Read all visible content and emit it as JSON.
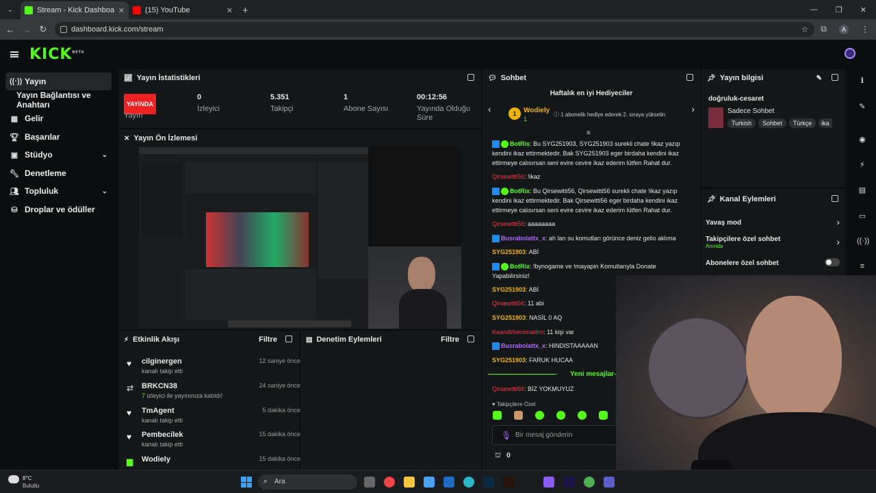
{
  "browser": {
    "tabs": [
      {
        "title": "Stream - Kick Dashboard",
        "active": true,
        "favicon_color": "#53fc18"
      },
      {
        "title": "(15) YouTube",
        "active": false,
        "favicon_color": "#ff0000"
      }
    ],
    "url": "dashboard.kick.com/stream",
    "profile_initial": "A"
  },
  "topbar": {
    "logo": "KICK",
    "logo_sup": "BETA"
  },
  "sidebar": {
    "items": [
      {
        "label": "Yayın",
        "icon": "broadcast-icon",
        "active": true
      },
      {
        "label": "Yayın Bağlantısı ve Anahtarı",
        "icon": "",
        "active": false
      },
      {
        "label": "Gelir",
        "icon": "revenue-icon",
        "active": false
      },
      {
        "label": "Başarılar",
        "icon": "trophy-icon",
        "active": false
      },
      {
        "label": "Stüdyo",
        "icon": "studio-icon",
        "active": false,
        "expandable": true
      },
      {
        "label": "Denetleme",
        "icon": "wrench-icon",
        "active": false
      },
      {
        "label": "Topluluk",
        "icon": "people-icon",
        "active": false,
        "expandable": true
      },
      {
        "label": "Droplar ve ödüller",
        "icon": "gift-icon",
        "active": false
      }
    ]
  },
  "stats": {
    "title": "Yayın İstatistikleri",
    "items": [
      {
        "value": "YAYINDA",
        "label": "Yayın"
      },
      {
        "value": "0",
        "label": "İzleyici"
      },
      {
        "value": "5.351",
        "label": "Takipçi"
      },
      {
        "value": "1",
        "label": "Abone Sayısı"
      },
      {
        "value": "00:12:56",
        "label": "Yayında Olduğu Süre"
      }
    ]
  },
  "preview": {
    "title": "Yayın Ön İzlemesi"
  },
  "activity": {
    "title": "Etkinlik Akışı",
    "filter_label": "Filtre",
    "items": [
      {
        "name": "cilginergen",
        "time": "12 saniye önce",
        "desc": "kanalı takip etti",
        "icon": "heart-icon"
      },
      {
        "name": "BRKCN38",
        "time": "24 saniye önce",
        "count": "7",
        "desc": "izleyici ile yayınınıza katıldı!",
        "icon": "raid-icon"
      },
      {
        "name": "TmAgent",
        "time": "5 dakika önce",
        "desc": "kanalı takip etti",
        "icon": "heart-icon"
      },
      {
        "name": "Pembecilek",
        "time": "15 dakika önce",
        "desc": "kanalı takip etti",
        "icon": "heart-icon"
      },
      {
        "name": "Wodiely",
        "time": "15 dakika önce",
        "desc": "",
        "icon": "gift-icon"
      }
    ]
  },
  "moderation": {
    "title": "Denetim Eylemleri",
    "filter_label": "Filtre"
  },
  "chat": {
    "title": "Sohbet",
    "gifters_title": "Haftalık en iyi Hediyeciler",
    "top_gifter": {
      "name": "Wodiely",
      "rank": "1",
      "count": "1"
    },
    "gifter_hint": "1 abonelik hediye ederek 2. sıraya yükselin",
    "messages": [
      {
        "user": "BotRix",
        "type": "bot",
        "text": "Bu SYG251903, SYG251903 surekli chate !ikaz yazıp kendini ikaz ettirmektedir. Bak SYG251903 eger birdaha kendini ikaz ettirmeye calısırsan seni evire cevire ikaz ederim lütfen Rahat dur."
      },
      {
        "user": "Qirsewitti56",
        "type": "red",
        "text": "!ikaz"
      },
      {
        "user": "BotRix",
        "type": "bot",
        "text": "Bu Qirsewitti56, Qirsewitti56 surekli chate !ikaz yazıp kendini ikaz ettirmektedir. Bak Qirsewitti56 eger birdaha kendini ikaz ettirmeye calısırsan seni evire cevire ikaz ederim lütfen Rahat dur."
      },
      {
        "user": "Qirsewitti56",
        "type": "red",
        "text": "aaaaaaaa"
      },
      {
        "user": "Busrabolattx_x",
        "type": "pur",
        "text": "ah lan su komutları görünce deniz gelio aklıma"
      },
      {
        "user": "SYG251903",
        "type": "yel",
        "text": "ABİ"
      },
      {
        "user": "BotRix",
        "type": "bot",
        "text": "!bynogame ve !mayapin Komutlarıyla Donate Yapabilirsiniz!"
      },
      {
        "user": "SYG251903",
        "type": "yel",
        "text": "ABİ"
      },
      {
        "user": "Qirsewitti56",
        "type": "red",
        "text": "11 abi"
      },
      {
        "user": "SYG251903",
        "type": "yel",
        "text": "NASİL 0 AQ"
      },
      {
        "user": "Kaandirbenimadim",
        "type": "red",
        "text": "11 kişi var"
      },
      {
        "user": "Busrabolattx_x",
        "type": "pur",
        "text": "HINDISTAAAAAN"
      },
      {
        "user": "SYG251903",
        "type": "yel",
        "text": "FARUK HUCAA"
      }
    ],
    "new_messages_label": "Yeni mesajlar",
    "after_new": {
      "user": "Qirsewitti56",
      "type": "red",
      "text": "BİZ YOKMUYUZ"
    },
    "followers_only": "Takipçilere Özel",
    "input_placeholder": "Bir mesaj gönderin",
    "points": "0"
  },
  "stream_info": {
    "title": "Yayın bilgisi",
    "stream_title": "doğruluk-cesaret",
    "category": "Sadece Sohbet",
    "tags": [
      "Turkish",
      "Sohbet",
      "Türkçe",
      "ika"
    ]
  },
  "channel_actions": {
    "title": "Kanal Eylemleri",
    "items": [
      {
        "label": "Yavaş mod",
        "sub": ""
      },
      {
        "label": "Takipçilere özel sohbet",
        "sub": "Anında"
      },
      {
        "label": "Abonelere özel sohbet",
        "sub": ""
      }
    ]
  },
  "taskbar": {
    "weather_temp": "8°C",
    "weather_desc": "Bulutlu",
    "search_placeholder": "Ara"
  },
  "colors": {
    "kick_green": "#53fc18",
    "live_red": "#e22222",
    "panel_bg": "#141718",
    "page_bg": "#0b0e0f"
  }
}
